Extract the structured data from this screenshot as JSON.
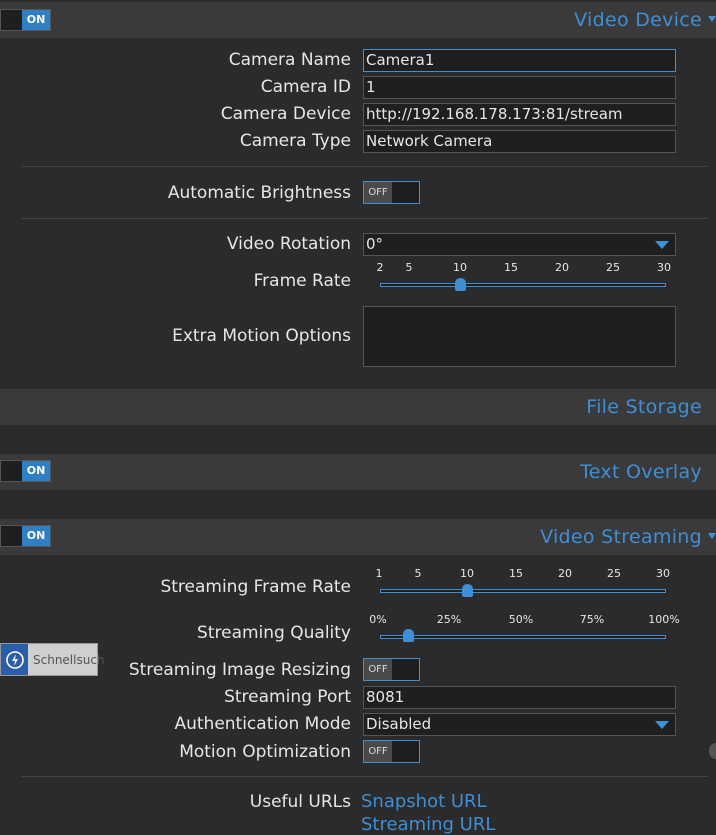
{
  "video_device": {
    "toggle": "ON",
    "title": "Video Device",
    "camera_name_label": "Camera Name",
    "camera_name": "Camera1",
    "camera_id_label": "Camera ID",
    "camera_id": "1",
    "camera_device_label": "Camera Device",
    "camera_device": "http://192.168.178.173:81/stream",
    "camera_type_label": "Camera Type",
    "camera_type": "Network Camera",
    "auto_brightness_label": "Automatic Brightness",
    "auto_brightness": "OFF",
    "video_rotation_label": "Video Rotation",
    "video_rotation": "0°",
    "frame_rate_label": "Frame Rate",
    "frame_rate_ticks": [
      "2",
      "5",
      "10",
      "15",
      "20",
      "25",
      "30"
    ],
    "frame_rate_value": 10,
    "extra_motion_label": "Extra Motion Options",
    "extra_motion_value": ""
  },
  "file_storage": {
    "title": "File Storage"
  },
  "text_overlay": {
    "toggle": "ON",
    "title": "Text Overlay"
  },
  "video_streaming": {
    "toggle": "ON",
    "title": "Video Streaming",
    "frame_rate_label": "Streaming Frame Rate",
    "frame_rate_ticks": [
      "1",
      "5",
      "10",
      "15",
      "20",
      "25",
      "30"
    ],
    "frame_rate_value": 10,
    "quality_label": "Streaming Quality",
    "quality_ticks": [
      "0%",
      "25%",
      "50%",
      "75%",
      "100%"
    ],
    "quality_value_percent": 10,
    "resizing_label": "Streaming Image Resizing",
    "resizing": "OFF",
    "port_label": "Streaming Port",
    "port": "8081",
    "auth_label": "Authentication Mode",
    "auth": "Disabled",
    "motion_opt_label": "Motion Optimization",
    "motion_opt": "OFF",
    "useful_urls_label": "Useful URLs",
    "snapshot_url": "Snapshot URL",
    "streaming_url": "Streaming URL"
  },
  "overlay_widget": {
    "label": "Schnellsuch"
  },
  "colors": {
    "accent": "#3d8fd6",
    "background": "#2b2b2b",
    "header": "#3a3a3a"
  }
}
